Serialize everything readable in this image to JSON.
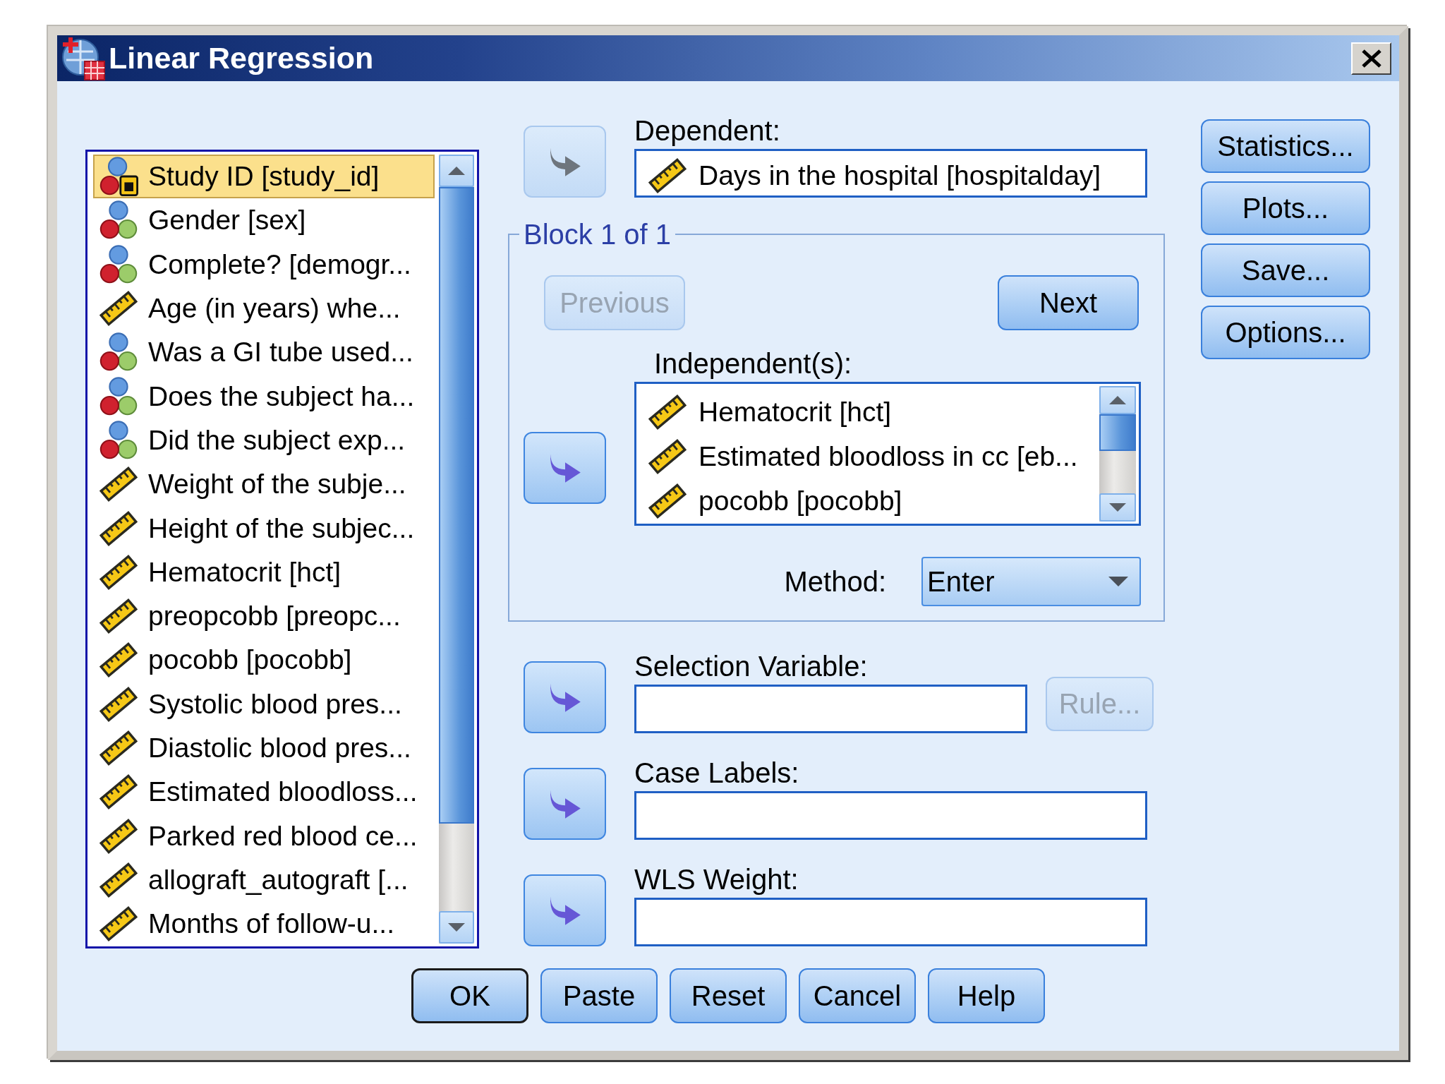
{
  "window": {
    "title": "Linear Regression"
  },
  "variables": {
    "items": [
      {
        "label": "Study ID [study_id]",
        "kind": "string",
        "selected": true
      },
      {
        "label": "Gender [sex]",
        "kind": "nominal",
        "selected": false
      },
      {
        "label": "Complete? [demogr...",
        "kind": "nominal",
        "selected": false
      },
      {
        "label": "Age (in years) whe...",
        "kind": "scale",
        "selected": false
      },
      {
        "label": "Was a GI tube used...",
        "kind": "nominal",
        "selected": false
      },
      {
        "label": "Does the subject ha...",
        "kind": "nominal",
        "selected": false
      },
      {
        "label": "Did the subject exp...",
        "kind": "nominal",
        "selected": false
      },
      {
        "label": "Weight of the subje...",
        "kind": "scale",
        "selected": false
      },
      {
        "label": "Height of the subjec...",
        "kind": "scale",
        "selected": false
      },
      {
        "label": "Hematocrit [hct]",
        "kind": "scale",
        "selected": false
      },
      {
        "label": "preopcobb [preopc...",
        "kind": "scale",
        "selected": false
      },
      {
        "label": "pocobb [pocobb]",
        "kind": "scale",
        "selected": false
      },
      {
        "label": "Systolic blood pres...",
        "kind": "scale",
        "selected": false
      },
      {
        "label": "Diastolic blood pres...",
        "kind": "scale",
        "selected": false
      },
      {
        "label": "Estimated bloodloss...",
        "kind": "scale",
        "selected": false
      },
      {
        "label": "Parked red blood ce...",
        "kind": "scale",
        "selected": false
      },
      {
        "label": "allograft_autograft [...",
        "kind": "scale",
        "selected": false
      },
      {
        "label": "Months of follow-u...",
        "kind": "scale",
        "selected": false
      }
    ]
  },
  "dependent": {
    "label": "Dependent:",
    "arrow_disabled": true,
    "value": {
      "label": "Days in the hospital [hospitalday]",
      "kind": "scale"
    }
  },
  "block": {
    "title": "Block 1 of 1",
    "nav_buttons": [
      {
        "label": "Previous",
        "disabled": true
      },
      {
        "label": "Next",
        "disabled": false
      }
    ],
    "independents": {
      "label": "Independent(s):",
      "arrow_disabled": false,
      "items": [
        {
          "label": "Hematocrit [hct]",
          "kind": "scale"
        },
        {
          "label": "Estimated bloodloss in cc [eb...",
          "kind": "scale"
        },
        {
          "label": "pocobb [pocobb]",
          "kind": "scale"
        }
      ]
    },
    "method": {
      "label": "Method:",
      "value": "Enter"
    }
  },
  "selection_variable": {
    "label": "Selection Variable:",
    "arrow_disabled": false,
    "rule_button": {
      "label": "Rule...",
      "disabled": true
    }
  },
  "case_labels": {
    "label": "Case Labels:",
    "arrow_disabled": false
  },
  "wls_weight": {
    "label": "WLS Weight:",
    "arrow_disabled": false
  },
  "side_buttons": [
    {
      "label": "Statistics..."
    },
    {
      "label": "Plots..."
    },
    {
      "label": "Save..."
    },
    {
      "label": "Options..."
    }
  ],
  "buttons": [
    {
      "label": "OK",
      "default": true
    },
    {
      "label": "Paste",
      "default": false
    },
    {
      "label": "Reset",
      "default": false
    },
    {
      "label": "Cancel",
      "default": false
    },
    {
      "label": "Help",
      "default": false
    }
  ]
}
